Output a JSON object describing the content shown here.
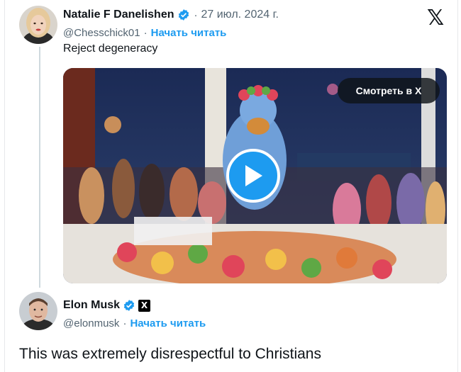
{
  "quoted_tweet": {
    "author_name": "Natalie F Danelishen",
    "date": "27 июл. 2024 г.",
    "separator": "·",
    "handle": "@Chesschick01",
    "follow_label": "Начать читать",
    "text": "Reject degeneracy",
    "media": {
      "watch_button_label": "Смотреть в X"
    }
  },
  "x_logo": "𝕏",
  "reply": {
    "author_name": "Elon Musk",
    "handle": "@elonmusk",
    "separator": "·",
    "follow_label": "Начать читать",
    "affiliation_badge": "X",
    "text": "This was extremely disrespectful to Christians"
  },
  "colors": {
    "link": "#1d9bf0",
    "muted": "#536471",
    "verified": "#1d9bf0"
  },
  "icons": [
    "verified-badge-icon",
    "x-logo-icon",
    "play-icon"
  ]
}
